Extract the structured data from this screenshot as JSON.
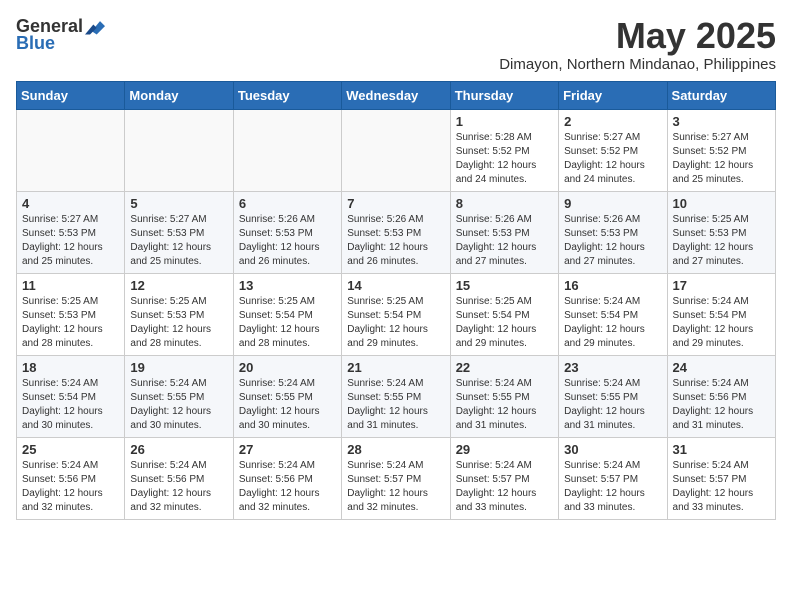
{
  "header": {
    "logo_general": "General",
    "logo_blue": "Blue",
    "month_title": "May 2025",
    "location": "Dimayon, Northern Mindanao, Philippines"
  },
  "days_of_week": [
    "Sunday",
    "Monday",
    "Tuesday",
    "Wednesday",
    "Thursday",
    "Friday",
    "Saturday"
  ],
  "weeks": [
    [
      {
        "day": "",
        "info": ""
      },
      {
        "day": "",
        "info": ""
      },
      {
        "day": "",
        "info": ""
      },
      {
        "day": "",
        "info": ""
      },
      {
        "day": "1",
        "info": "Sunrise: 5:28 AM\nSunset: 5:52 PM\nDaylight: 12 hours and 24 minutes."
      },
      {
        "day": "2",
        "info": "Sunrise: 5:27 AM\nSunset: 5:52 PM\nDaylight: 12 hours and 24 minutes."
      },
      {
        "day": "3",
        "info": "Sunrise: 5:27 AM\nSunset: 5:52 PM\nDaylight: 12 hours and 25 minutes."
      }
    ],
    [
      {
        "day": "4",
        "info": "Sunrise: 5:27 AM\nSunset: 5:53 PM\nDaylight: 12 hours and 25 minutes."
      },
      {
        "day": "5",
        "info": "Sunrise: 5:27 AM\nSunset: 5:53 PM\nDaylight: 12 hours and 25 minutes."
      },
      {
        "day": "6",
        "info": "Sunrise: 5:26 AM\nSunset: 5:53 PM\nDaylight: 12 hours and 26 minutes."
      },
      {
        "day": "7",
        "info": "Sunrise: 5:26 AM\nSunset: 5:53 PM\nDaylight: 12 hours and 26 minutes."
      },
      {
        "day": "8",
        "info": "Sunrise: 5:26 AM\nSunset: 5:53 PM\nDaylight: 12 hours and 27 minutes."
      },
      {
        "day": "9",
        "info": "Sunrise: 5:26 AM\nSunset: 5:53 PM\nDaylight: 12 hours and 27 minutes."
      },
      {
        "day": "10",
        "info": "Sunrise: 5:25 AM\nSunset: 5:53 PM\nDaylight: 12 hours and 27 minutes."
      }
    ],
    [
      {
        "day": "11",
        "info": "Sunrise: 5:25 AM\nSunset: 5:53 PM\nDaylight: 12 hours and 28 minutes."
      },
      {
        "day": "12",
        "info": "Sunrise: 5:25 AM\nSunset: 5:53 PM\nDaylight: 12 hours and 28 minutes."
      },
      {
        "day": "13",
        "info": "Sunrise: 5:25 AM\nSunset: 5:54 PM\nDaylight: 12 hours and 28 minutes."
      },
      {
        "day": "14",
        "info": "Sunrise: 5:25 AM\nSunset: 5:54 PM\nDaylight: 12 hours and 29 minutes."
      },
      {
        "day": "15",
        "info": "Sunrise: 5:25 AM\nSunset: 5:54 PM\nDaylight: 12 hours and 29 minutes."
      },
      {
        "day": "16",
        "info": "Sunrise: 5:24 AM\nSunset: 5:54 PM\nDaylight: 12 hours and 29 minutes."
      },
      {
        "day": "17",
        "info": "Sunrise: 5:24 AM\nSunset: 5:54 PM\nDaylight: 12 hours and 29 minutes."
      }
    ],
    [
      {
        "day": "18",
        "info": "Sunrise: 5:24 AM\nSunset: 5:54 PM\nDaylight: 12 hours and 30 minutes."
      },
      {
        "day": "19",
        "info": "Sunrise: 5:24 AM\nSunset: 5:55 PM\nDaylight: 12 hours and 30 minutes."
      },
      {
        "day": "20",
        "info": "Sunrise: 5:24 AM\nSunset: 5:55 PM\nDaylight: 12 hours and 30 minutes."
      },
      {
        "day": "21",
        "info": "Sunrise: 5:24 AM\nSunset: 5:55 PM\nDaylight: 12 hours and 31 minutes."
      },
      {
        "day": "22",
        "info": "Sunrise: 5:24 AM\nSunset: 5:55 PM\nDaylight: 12 hours and 31 minutes."
      },
      {
        "day": "23",
        "info": "Sunrise: 5:24 AM\nSunset: 5:55 PM\nDaylight: 12 hours and 31 minutes."
      },
      {
        "day": "24",
        "info": "Sunrise: 5:24 AM\nSunset: 5:56 PM\nDaylight: 12 hours and 31 minutes."
      }
    ],
    [
      {
        "day": "25",
        "info": "Sunrise: 5:24 AM\nSunset: 5:56 PM\nDaylight: 12 hours and 32 minutes."
      },
      {
        "day": "26",
        "info": "Sunrise: 5:24 AM\nSunset: 5:56 PM\nDaylight: 12 hours and 32 minutes."
      },
      {
        "day": "27",
        "info": "Sunrise: 5:24 AM\nSunset: 5:56 PM\nDaylight: 12 hours and 32 minutes."
      },
      {
        "day": "28",
        "info": "Sunrise: 5:24 AM\nSunset: 5:57 PM\nDaylight: 12 hours and 32 minutes."
      },
      {
        "day": "29",
        "info": "Sunrise: 5:24 AM\nSunset: 5:57 PM\nDaylight: 12 hours and 33 minutes."
      },
      {
        "day": "30",
        "info": "Sunrise: 5:24 AM\nSunset: 5:57 PM\nDaylight: 12 hours and 33 minutes."
      },
      {
        "day": "31",
        "info": "Sunrise: 5:24 AM\nSunset: 5:57 PM\nDaylight: 12 hours and 33 minutes."
      }
    ]
  ]
}
